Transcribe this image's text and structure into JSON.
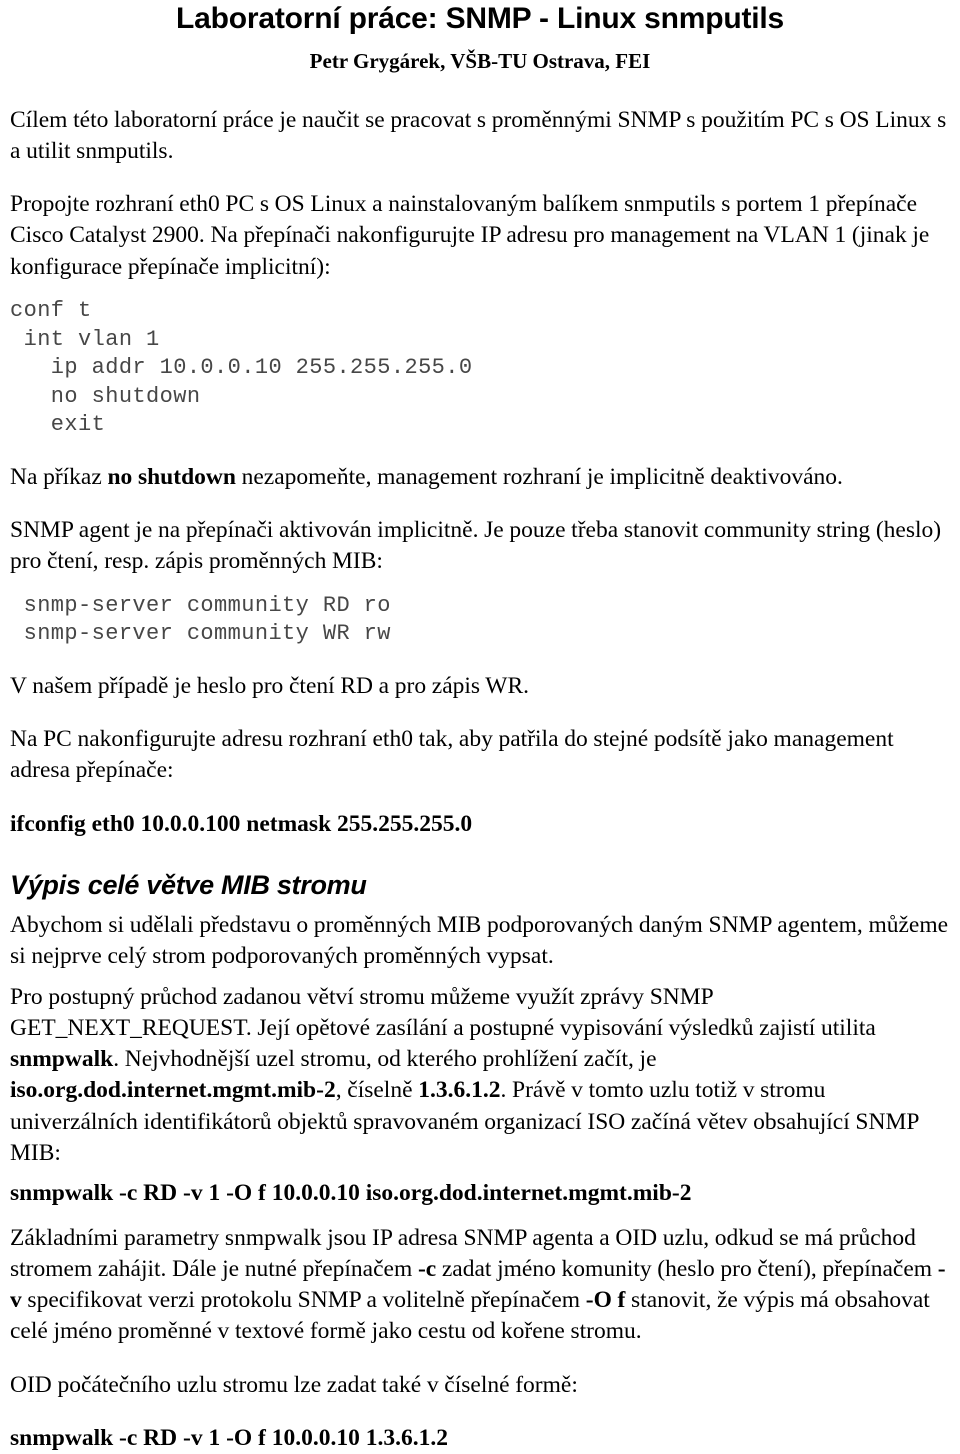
{
  "document": {
    "title": "Laboratorní práce: SNMP - Linux snmputils",
    "subtitle": "Petr Grygárek, VŠB-TU Ostrava, FEI"
  },
  "intro": {
    "paragraph": "Cílem této laboratorní práce je naučit se pracovat s proměnnými SNMP s použitím PC s OS Linux s a utilit snmputils."
  },
  "setup": {
    "paragraph": "Propojte rozhraní eth0 PC s OS Linux a nainstalovaným balíkem snmputils s portem 1 přepínače Cisco Catalyst 2900. Na přepínači nakonfigurujte IP adresu pro management na VLAN 1 (jinak je konfigurace přepínače implicitní):",
    "code": "conf t\n int vlan 1\n   ip addr 10.0.0.10 255.255.255.0\n   no shutdown\n   exit",
    "note_prefix": "Na příkaz ",
    "note_bold": "no shutdown",
    "note_suffix": " nezapomeňte, management rozhraní je implicitně deaktivováno."
  },
  "community": {
    "paragraph": "SNMP agent je na přepínači aktivován implicitně. Je pouze třeba stanovit community string (heslo) pro čtení, resp. zápis proměnných MIB:",
    "code": " snmp-server community RD ro\n snmp-server community WR rw",
    "note": "V našem případě je heslo pro čtení RD a pro zápis WR."
  },
  "pc_config": {
    "paragraph": "Na PC nakonfigurujte adresu rozhraní eth0 tak, aby patřila do stejné podsítě jako management adresa přepínače:",
    "command": "ifconfig eth0 10.0.0.100 netmask 255.255.255.0"
  },
  "mib_section": {
    "heading": "Výpis celé větve MIB stromu",
    "paragraph1": "Abychom si udělali představu o proměnných MIB podporovaných daným SNMP agentem, můžeme si nejprve celý strom podporovaných proměnných vypsat.",
    "p2_part1": "Pro postupný průchod zadanou větví stromu můžeme využít zprávy SNMP GET_NEXT_REQUEST. Její opětové zasílání a postupné vypisování výsledků zajistí utilita ",
    "p2_bold1": "snmpwalk",
    "p2_part2": ". Nejvhodnější uzel stromu, od kterého prohlížení začít, je ",
    "p2_bold2": "iso.org.dod.internet.mgmt.mib-2",
    "p2_part3": ", číselně ",
    "p2_bold3": "1.3.6.1.2",
    "p2_part4": ". Právě v tomto uzlu totiž v stromu univerzálních identifikátorů objektů spravovaném organizací ISO začíná větev obsahující SNMP MIB:",
    "command1": "snmpwalk -c RD -v 1 -O f 10.0.0.10 iso.org.dod.internet.mgmt.mib-2",
    "p3_part1": "Základními parametry snmpwalk jsou IP adresa SNMP agenta a OID uzlu, odkud se má průchod stromem zahájit. Dále je nutné přepínačem ",
    "p3_bold1": "-c",
    "p3_part2": " zadat jméno komunity (heslo pro čtení), přepínačem ",
    "p3_bold2": "-v",
    "p3_part3": " specifikovat verzi protokolu SNMP a volitelně přepínačem ",
    "p3_bold3": "-O f",
    "p3_part4": " stanovit, že výpis má obsahovat celé jméno proměnné v textové formě jako cestu od kořene stromu.",
    "p4": "OID počátečního uzlu stromu lze zadat také v číselné formě:",
    "command2": "snmpwalk -c RD -v 1 -O f 10.0.0.10 1.3.6.1.2"
  }
}
